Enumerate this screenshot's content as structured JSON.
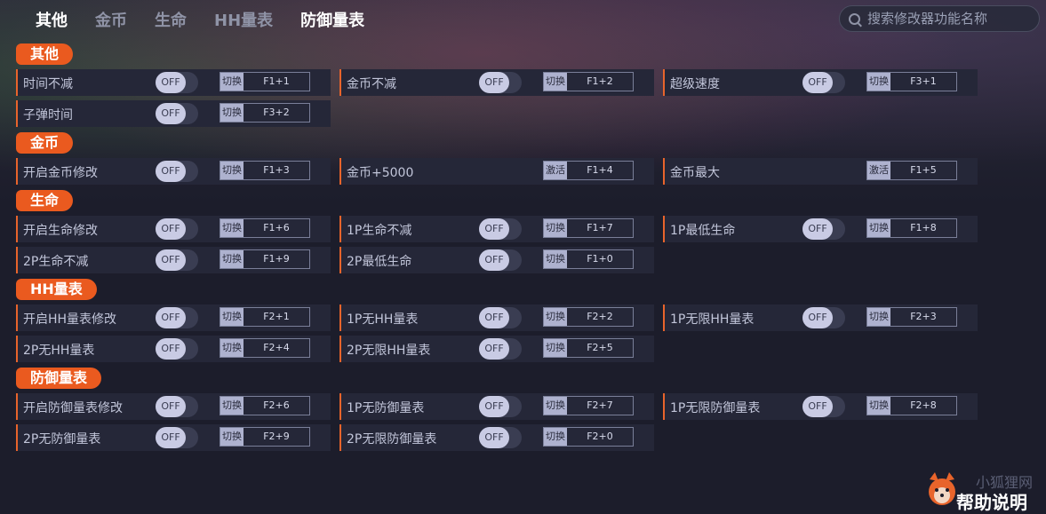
{
  "nav": {
    "tabs": [
      {
        "label": "其他"
      },
      {
        "label": "金币"
      },
      {
        "label": "生命"
      },
      {
        "label": "HH量表"
      },
      {
        "label": "防御量表"
      }
    ]
  },
  "search": {
    "placeholder": "搜索修改器功能名称"
  },
  "toggle_label": "OFF",
  "sections": [
    {
      "title": "其他"
    },
    {
      "title": "金币"
    },
    {
      "title": "生命"
    },
    {
      "title": "HH量表"
    },
    {
      "title": "防御量表"
    }
  ],
  "cheats": {
    "other": [
      {
        "label": "时间不减",
        "mode": "切换",
        "key": "F1+1"
      },
      {
        "label": "金币不减",
        "mode": "切换",
        "key": "F1+2"
      },
      {
        "label": "超级速度",
        "mode": "切换",
        "key": "F3+1"
      },
      {
        "label": "子弹时间",
        "mode": "切换",
        "key": "F3+2"
      }
    ],
    "gold": [
      {
        "label": "开启金币修改",
        "mode": "切换",
        "key": "F1+3"
      },
      {
        "label": "金币+5000",
        "mode": "激活",
        "key": "F1+4"
      },
      {
        "label": "金币最大",
        "mode": "激活",
        "key": "F1+5"
      }
    ],
    "life": [
      {
        "label": "开启生命修改",
        "mode": "切换",
        "key": "F1+6"
      },
      {
        "label": "1P生命不减",
        "mode": "切换",
        "key": "F1+7"
      },
      {
        "label": "1P最低生命",
        "mode": "切换",
        "key": "F1+8"
      },
      {
        "label": "2P生命不减",
        "mode": "切换",
        "key": "F1+9"
      },
      {
        "label": "2P最低生命",
        "mode": "切换",
        "key": "F1+0"
      }
    ],
    "hh": [
      {
        "label": "开启HH量表修改",
        "mode": "切换",
        "key": "F2+1"
      },
      {
        "label": "1P无HH量表",
        "mode": "切换",
        "key": "F2+2"
      },
      {
        "label": "1P无限HH量表",
        "mode": "切换",
        "key": "F2+3"
      },
      {
        "label": "2P无HH量表",
        "mode": "切换",
        "key": "F2+4"
      },
      {
        "label": "2P无限HH量表",
        "mode": "切换",
        "key": "F2+5"
      }
    ],
    "defense": [
      {
        "label": "开启防御量表修改",
        "mode": "切换",
        "key": "F2+6"
      },
      {
        "label": "1P无防御量表",
        "mode": "切换",
        "key": "F2+7"
      },
      {
        "label": "1P无限防御量表",
        "mode": "切换",
        "key": "F2+8"
      },
      {
        "label": "2P无防御量表",
        "mode": "切换",
        "key": "F2+9"
      },
      {
        "label": "2P无限防御量表",
        "mode": "切换",
        "key": "F2+0"
      }
    ]
  },
  "footer": {
    "brand": "小狐狸网",
    "help": "帮助说明"
  }
}
